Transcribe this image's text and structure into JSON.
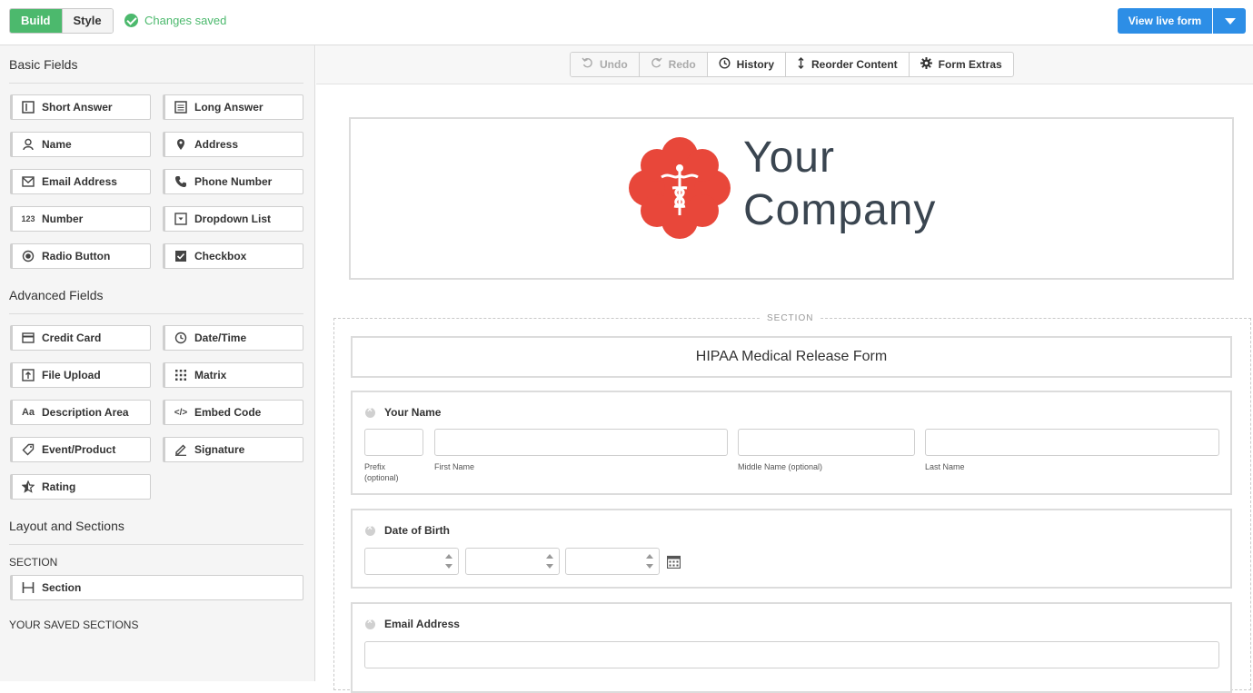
{
  "topbar": {
    "tabs": [
      "Build",
      "Style"
    ],
    "status": "Changes saved",
    "view_button": "View live form"
  },
  "sidebar": {
    "basic_title": "Basic Fields",
    "basic": [
      "Short Answer",
      "Long Answer",
      "Name",
      "Address",
      "Email Address",
      "Phone Number",
      "Number",
      "Dropdown List",
      "Radio Button",
      "Checkbox"
    ],
    "advanced_title": "Advanced Fields",
    "advanced": [
      "Credit Card",
      "Date/Time",
      "File Upload",
      "Matrix",
      "Description Area",
      "Embed Code",
      "Event/Product",
      "Signature",
      "Rating"
    ],
    "layout_title": "Layout and Sections",
    "section_caption": "SECTION",
    "section_button": "Section",
    "saved_caption": "YOUR SAVED SECTIONS",
    "number_icon_text": "123",
    "desc_icon_text": "Aa",
    "embed_icon_text": "</>"
  },
  "toolbar": {
    "undo": "Undo",
    "redo": "Redo",
    "history": "History",
    "reorder": "Reorder Content",
    "extras": "Form Extras"
  },
  "form": {
    "logo_line1": "Your",
    "logo_line2": "Company",
    "section_label": "SECTION",
    "title": "HIPAA Medical Release Form",
    "name_field": {
      "label": "Your Name",
      "prefix": "Prefix (optional)",
      "first": "First Name",
      "middle": "Middle Name (optional)",
      "last": "Last Name"
    },
    "dob_label": "Date of Birth",
    "email_label": "Email Address"
  },
  "colors": {
    "build_green": "#4cb96d",
    "view_blue": "#2d8ee6",
    "logo_red": "#e8473a"
  }
}
